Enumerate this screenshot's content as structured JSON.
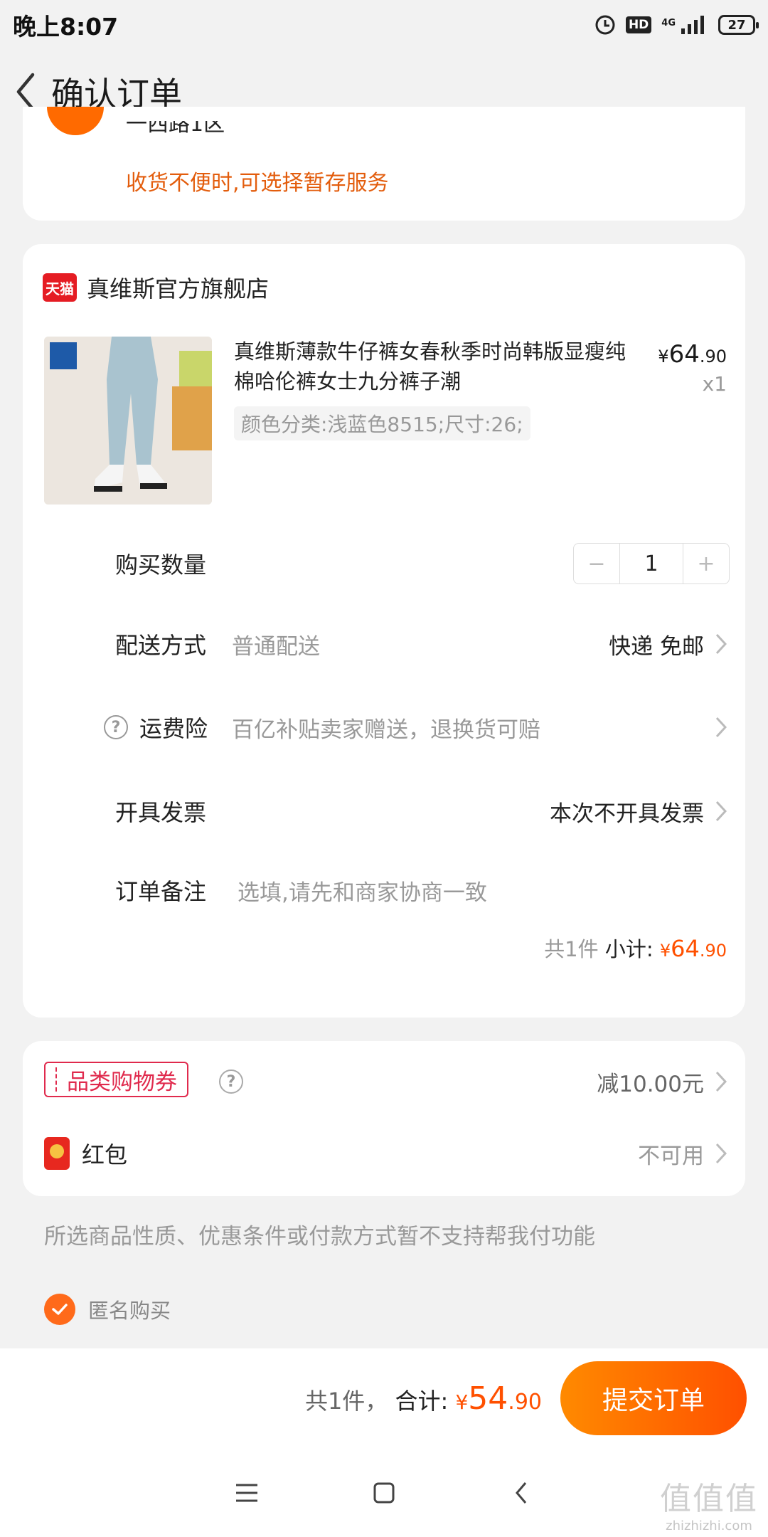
{
  "status_bar": {
    "time": "晚上8:07",
    "hd": "HD",
    "network": "4G",
    "battery": "27"
  },
  "nav": {
    "title": "确认订单"
  },
  "address": {
    "street_partial": "一西路1区",
    "storage_hint": "收货不便时,可选择暂存服务"
  },
  "shop": {
    "badge": "天猫",
    "name": "真维斯官方旗舰店",
    "product": {
      "title": "真维斯薄款牛仔裤女春秋季时尚韩版显瘦纯棉哈伦裤女士九分裤子潮",
      "sku": "颜色分类:浅蓝色8515;尺寸:26;",
      "price_yen": "¥",
      "price_int": "64",
      "price_dec": ".90",
      "quantity": "x1"
    },
    "quantity_row": {
      "label": "购买数量",
      "minus": "−",
      "value": "1",
      "plus": "+"
    },
    "delivery": {
      "label": "配送方式",
      "sub": "普通配送",
      "value": "快递 免邮"
    },
    "shipping_insurance": {
      "label": "运费险",
      "sub": "百亿补贴卖家赠送，退换货可赔"
    },
    "invoice": {
      "label": "开具发票",
      "value": "本次不开具发票"
    },
    "remark": {
      "label": "订单备注",
      "placeholder": "选填,请先和商家协商一致"
    },
    "subtotal": {
      "count": "共1件",
      "label": "小计:",
      "yen": "¥",
      "int": "64",
      "dec": ".90"
    }
  },
  "promotions": {
    "coupon": {
      "label": "品类购物券",
      "value": "减10.00元"
    },
    "red_packet": {
      "label": "红包",
      "value": "不可用"
    }
  },
  "notice": "所选商品性质、优惠条件或付款方式暂不支持帮我付功能",
  "anonymous": {
    "label": "匿名购买",
    "checked": true
  },
  "footer": {
    "count": "共1件，",
    "total_label": "合计:",
    "yen": "¥",
    "int": "54",
    "dec": ".90",
    "submit": "提交订单"
  },
  "watermark": {
    "text": "值值值",
    "site": "zhizhizhi.com"
  },
  "colors": {
    "accent": "#ff5000",
    "hint_orange": "#e35d0d",
    "coupon_red": "#e02a4d",
    "tmall_red": "#e51c23"
  }
}
